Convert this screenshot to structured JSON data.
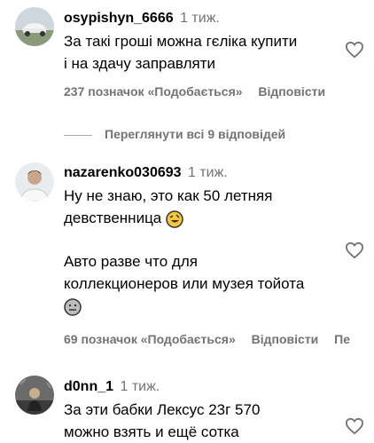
{
  "comments": [
    {
      "username": "osypishyn_6666",
      "time": "1 тиж.",
      "lines": [
        "За такі гроші можна гєліка купити",
        "і на здачу заправляти"
      ],
      "likes": "237 позначок «Подобається»",
      "reply": "Відповісти",
      "view_replies": "Переглянути всі 9 відповідей"
    },
    {
      "username": "nazarenko030693",
      "time": "1 тиж.",
      "lines": [
        "Ну не знаю, это как 50 летняя",
        "девственница",
        "Авто разве что для",
        "коллекционеров или музея тойота"
      ],
      "likes": "69 позначок «Подобається»",
      "reply": "Відповісти",
      "extra": "Пе"
    },
    {
      "username": "d0nn_1",
      "time": "1 тиж.",
      "lines": [
        "За эти бабки Лексус 23г 570",
        "можно взять и ещё сотка"
      ]
    }
  ],
  "icons": {
    "like": "heart-outline-icon",
    "emoji_laugh": "rolling-laughing-emoji",
    "emoji_shrug": "neutral-face-emoji"
  }
}
